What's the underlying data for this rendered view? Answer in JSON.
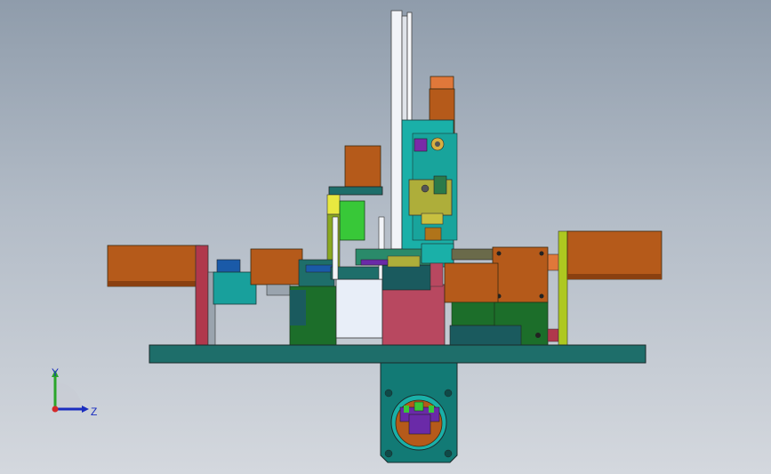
{
  "viewport": {
    "background_top": "#8f9cab",
    "background_bottom": "#d4d8de"
  },
  "model": {
    "colors": {
      "motor_orange": "#b55a1a",
      "motor_cap": "#e0783a",
      "base_teal": "#1e6e6a",
      "plate_teal": "#127a75",
      "cyan_part": "#1ab0a8",
      "green_block": "#1c6e2a",
      "bright_green": "#38c838",
      "rose_block": "#b84860",
      "olive_bar": "#8aa820",
      "violet_part": "#6a2aa8",
      "white_part": "#e8eef8",
      "rail_white": "#f2f4f8",
      "dark_teal": "#1a5a5e",
      "red_column": "#b0384c",
      "yellow_tab": "#e8e840"
    }
  },
  "triad": {
    "y_label": "Y",
    "z_label": "Z",
    "y_color": "#2aa62a",
    "z_color": "#1a2dbf",
    "origin_color": "#d42a2a"
  }
}
